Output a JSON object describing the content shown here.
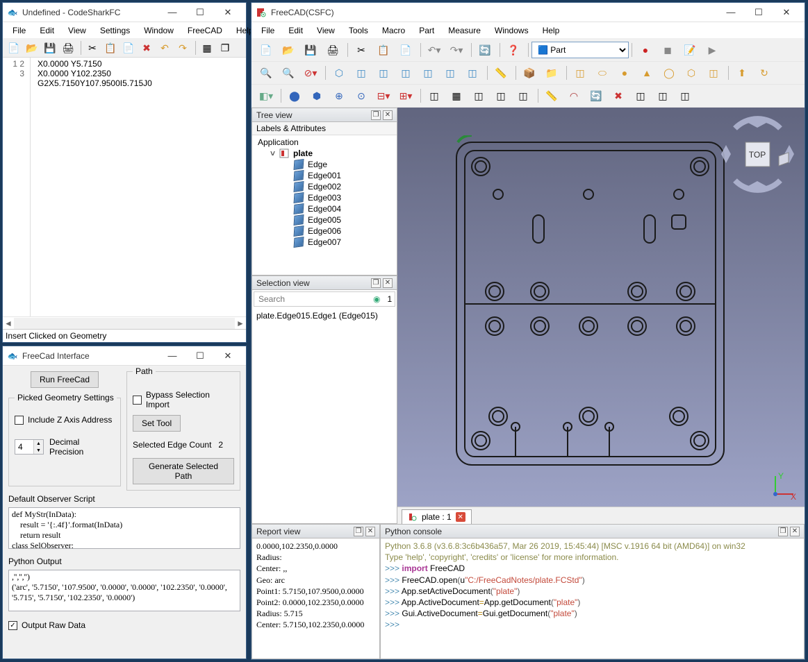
{
  "codeshark": {
    "title": "Undefined - CodeSharkFC",
    "menu": [
      "File",
      "Edit",
      "View",
      "Settings",
      "Window",
      "FreeCAD",
      "Help"
    ],
    "lines": [
      "1",
      "2",
      "3"
    ],
    "code": [
      "X0.0000 Y5.7150",
      "X0.0000 Y102.2350",
      "G2X5.7150Y107.9500I5.715J0"
    ],
    "status": "Insert Clicked on Geometry"
  },
  "fcif": {
    "title": "FreeCad Interface",
    "run_btn": "Run FreeCad",
    "geom_legend": "Picked Geometry Settings",
    "include_z": "Include Z Axis Address",
    "decimal_label": "Decimal Precision",
    "decimal_value": "4",
    "path_legend": "Path",
    "bypass": "Bypass Selection Import",
    "set_tool": "Set Tool",
    "edge_count_label": "Selected Edge Count",
    "edge_count": "2",
    "gen_path": "Generate Selected Path",
    "script_label": "Default Observer Script",
    "script_text": "def MyStr(InData):\n    result = '{:.4f}'.format(InData)\n    return result\nclass SelObserver:",
    "pyout_label": "Python Output",
    "pyout_text": ",'','','')\n('arc', '5.7150', '107.9500', '0.0000', '0.0000', '102.2350', '0.0000', '5.715', '5.7150', '102.2350', '0.0000')",
    "output_raw": "Output Raw Data"
  },
  "freecad": {
    "title": "FreeCAD(CSFC)",
    "menu": [
      "File",
      "Edit",
      "View",
      "Tools",
      "Macro",
      "Part",
      "Measure",
      "Windows",
      "Help"
    ],
    "workbench": "Part",
    "treeview_title": "Tree view",
    "tree_head": "Labels & Attributes",
    "tree_root": "Application",
    "tree_doc": "plate",
    "tree_items": [
      "Edge",
      "Edge001",
      "Edge002",
      "Edge003",
      "Edge004",
      "Edge005",
      "Edge006",
      "Edge007"
    ],
    "selview_title": "Selection view",
    "search_placeholder": "Search",
    "sel_count": "1",
    "selection_item": "plate.Edge015.Edge1 (Edge015)",
    "doc_tab_name": "plate : 1",
    "report_title": "Report view",
    "report_text": "0.0000,102.2350,0.0000\nRadius:\nCenter: ,,\nGeo:    arc\nPoint1: 5.7150,107.9500,0.0000\nPoint2: 0.0000,102.2350,0.0000\nRadius: 5.715\nCenter: 5.7150,102.2350,0.0000",
    "pycon_title": "Python console",
    "py_header1": "Python 3.6.8 (v3.6.8:3c6b436a57, Mar 26 2019, 15:45:44) [MSC v.1916 64 bit (AMD64)] on win32",
    "py_header2": "Type 'help', 'copyright', 'credits' or 'license' for more information.",
    "py_lines": [
      {
        "prompt": ">>> ",
        "parts": [
          {
            "t": "import ",
            "c": "kw-import"
          },
          {
            "t": "FreeCAD",
            "c": "kw-mod"
          }
        ]
      },
      {
        "prompt": ">>> ",
        "parts": [
          {
            "t": "FreeCAD",
            "c": "kw-mod"
          },
          {
            "t": ".",
            "c": "kw-dot"
          },
          {
            "t": "open",
            "c": "kw-mod"
          },
          {
            "t": "(",
            "c": "kw-paren"
          },
          {
            "t": "u",
            "c": "kw-mod"
          },
          {
            "t": "\"C:/FreeCadNotes/plate.FCStd\"",
            "c": "kw-str"
          },
          {
            "t": ")",
            "c": "kw-paren"
          }
        ]
      },
      {
        "prompt": ">>> ",
        "parts": [
          {
            "t": "App",
            "c": "kw-mod"
          },
          {
            "t": ".",
            "c": "kw-dot"
          },
          {
            "t": "setActiveDocument",
            "c": "kw-mod"
          },
          {
            "t": "(",
            "c": "kw-paren"
          },
          {
            "t": "\"plate\"",
            "c": "kw-str"
          },
          {
            "t": ")",
            "c": "kw-paren"
          }
        ]
      },
      {
        "prompt": ">>> ",
        "parts": [
          {
            "t": "App",
            "c": "kw-mod"
          },
          {
            "t": ".",
            "c": "kw-dot"
          },
          {
            "t": "ActiveDocument",
            "c": "kw-mod"
          },
          {
            "t": "=",
            "c": "kw-gold"
          },
          {
            "t": "App",
            "c": "kw-mod"
          },
          {
            "t": ".",
            "c": "kw-dot"
          },
          {
            "t": "getDocument",
            "c": "kw-mod"
          },
          {
            "t": "(",
            "c": "kw-paren"
          },
          {
            "t": "\"plate\"",
            "c": "kw-str"
          },
          {
            "t": ")",
            "c": "kw-paren"
          }
        ]
      },
      {
        "prompt": ">>> ",
        "parts": [
          {
            "t": "Gui",
            "c": "kw-mod"
          },
          {
            "t": ".",
            "c": "kw-dot"
          },
          {
            "t": "ActiveDocument",
            "c": "kw-mod"
          },
          {
            "t": "=",
            "c": "kw-gold"
          },
          {
            "t": "Gui",
            "c": "kw-mod"
          },
          {
            "t": ".",
            "c": "kw-dot"
          },
          {
            "t": "getDocument",
            "c": "kw-mod"
          },
          {
            "t": "(",
            "c": "kw-paren"
          },
          {
            "t": "\"plate\"",
            "c": "kw-str"
          },
          {
            "t": ")",
            "c": "kw-paren"
          }
        ]
      },
      {
        "prompt": ">>> ",
        "parts": []
      }
    ]
  }
}
